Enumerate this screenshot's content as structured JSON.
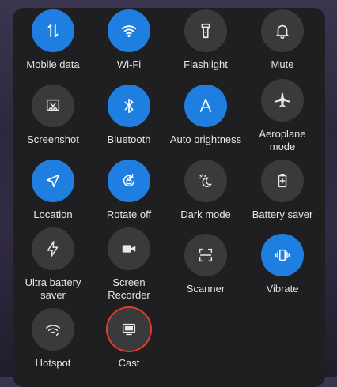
{
  "tiles": [
    {
      "label": "Mobile data",
      "icon": "mobile-data-icon",
      "active": true
    },
    {
      "label": "Wi-Fi",
      "icon": "wifi-icon",
      "active": true
    },
    {
      "label": "Flashlight",
      "icon": "flashlight-icon",
      "active": false
    },
    {
      "label": "Mute",
      "icon": "bell-icon",
      "active": false
    },
    {
      "label": "Screenshot",
      "icon": "screenshot-icon",
      "active": false
    },
    {
      "label": "Bluetooth",
      "icon": "bluetooth-icon",
      "active": true
    },
    {
      "label": "Auto brightness",
      "icon": "auto-brightness-icon",
      "active": true
    },
    {
      "label": "Aeroplane\nmode",
      "icon": "airplane-icon",
      "active": false
    },
    {
      "label": "Location",
      "icon": "location-icon",
      "active": true
    },
    {
      "label": "Rotate off",
      "icon": "rotate-lock-icon",
      "active": true
    },
    {
      "label": "Dark mode",
      "icon": "dark-mode-icon",
      "active": false
    },
    {
      "label": "Battery saver",
      "icon": "battery-saver-icon",
      "active": false
    },
    {
      "label": "Ultra battery\nsaver",
      "icon": "ultra-battery-saver-icon",
      "active": false
    },
    {
      "label": "Screen\nRecorder",
      "icon": "screen-recorder-icon",
      "active": false
    },
    {
      "label": "Scanner",
      "icon": "scanner-icon",
      "active": false
    },
    {
      "label": "Vibrate",
      "icon": "vibrate-icon",
      "active": true
    },
    {
      "label": "Hotspot",
      "icon": "hotspot-icon",
      "active": false
    },
    {
      "label": "Cast",
      "icon": "cast-icon",
      "active": false,
      "highlighted": true
    }
  ],
  "colors": {
    "active": "#1f7fe0",
    "inactive": "#3a3a3c",
    "highlight_ring": "#e53b2a"
  }
}
